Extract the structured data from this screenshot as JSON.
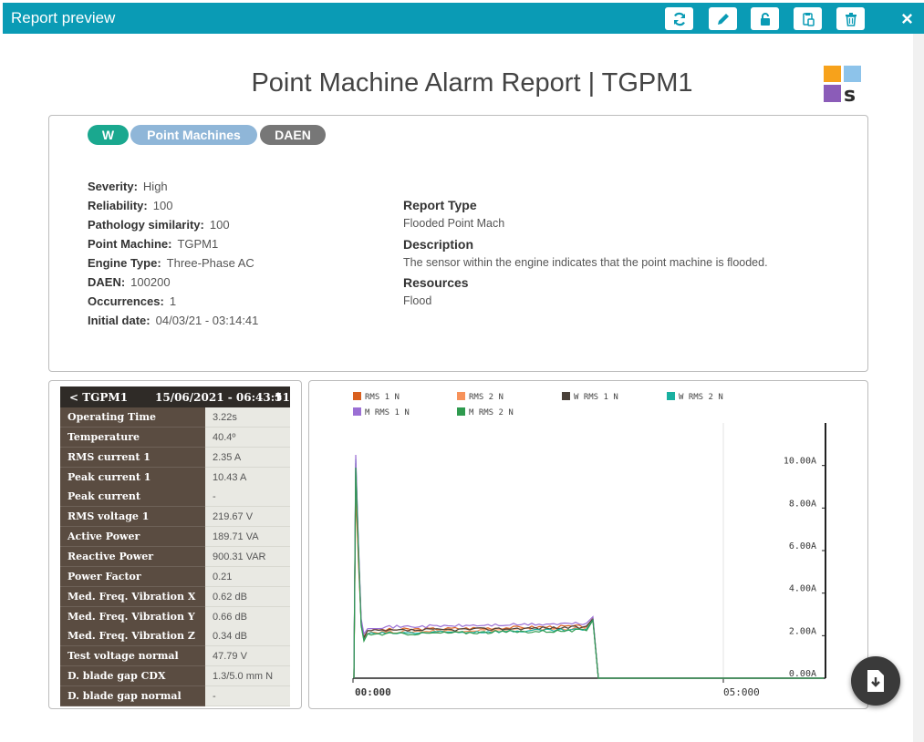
{
  "window": {
    "title": "Report preview"
  },
  "report": {
    "title": "Point Machine Alarm Report | TGPM1",
    "tags": [
      "W",
      "Point Machines",
      "DAEN"
    ],
    "tag_colors": [
      "#1aa88f",
      "#8fb6d8",
      "#777777"
    ],
    "details": [
      {
        "key": "Severity:",
        "value": "High"
      },
      {
        "key": "Reliability:",
        "value": "100"
      },
      {
        "key": "Pathology similarity:",
        "value": "100"
      },
      {
        "key": "Point Machine:",
        "value": "TGPM1"
      },
      {
        "key": "Engine Type:",
        "value": "Three-Phase AC"
      },
      {
        "key": "DAEN:",
        "value": "100200"
      },
      {
        "key": "Occurrences:",
        "value": "1"
      },
      {
        "key": "Initial date:",
        "value": "04/03/21 - 03:14:41"
      }
    ],
    "report_type_label": "Report Type",
    "report_type_value": "Flooded Point Mach",
    "description_label": "Description",
    "description_value": "The sensor within the engine indicates that the point machine is flooded.",
    "resources_label": "Resources",
    "resources_value": "Flood"
  },
  "table": {
    "back_label": "< TGPM1",
    "timestamp": "15/06/2021 - 06:43:51",
    "rows": [
      {
        "label": "Operating Time",
        "value": "3.22s"
      },
      {
        "label": "Temperature",
        "value": "40.4º"
      },
      {
        "label": "RMS current 1",
        "value": "2.35 A"
      },
      {
        "label": "Peak current 1",
        "value": "10.43 A"
      },
      {
        "label": "Peak current",
        "value": "-"
      },
      {
        "label": "RMS voltage 1",
        "value": "219.67 V"
      },
      {
        "label": "Active Power",
        "value": "189.71 VA"
      },
      {
        "label": "Reactive Power",
        "value": "900.31 VAR"
      },
      {
        "label": "Power Factor",
        "value": "0.21"
      },
      {
        "label": "Med. Freq. Vibration X",
        "value": "0.62 dB"
      },
      {
        "label": "Med. Freq. Vibration Y",
        "value": "0.66 dB"
      },
      {
        "label": "Med. Freq. Vibration Z",
        "value": "0.34 dB"
      },
      {
        "label": "Test voltage normal",
        "value": "47.79 V"
      },
      {
        "label": "D. blade gap CDX",
        "value": "1.3/5.0 mm N"
      },
      {
        "label": "D. blade gap normal",
        "value": "-"
      }
    ]
  },
  "chart_data": {
    "type": "line",
    "legend": [
      {
        "name": "RMS 1 N",
        "color": "#d9601f"
      },
      {
        "name": "RMS 2 N",
        "color": "#f7925a"
      },
      {
        "name": "W RMS 1 N",
        "color": "#4a413a"
      },
      {
        "name": "W RMS 2 N",
        "color": "#19b0a0"
      },
      {
        "name": "M RMS 1 N",
        "color": "#9b6fd4"
      },
      {
        "name": "M RMS 2 N",
        "color": "#2e9a4e"
      }
    ],
    "x_ticks": [
      "00:000",
      "05:000"
    ],
    "y_ticks": [
      "0.00A",
      "2.00A",
      "4.00A",
      "6.00A",
      "8.00A",
      "10.00A"
    ],
    "ylim": [
      0,
      12
    ],
    "y_axis_side": "right",
    "series_profile": {
      "peak": 10.5,
      "plateau": 2.3,
      "end_bump": 2.8
    }
  }
}
